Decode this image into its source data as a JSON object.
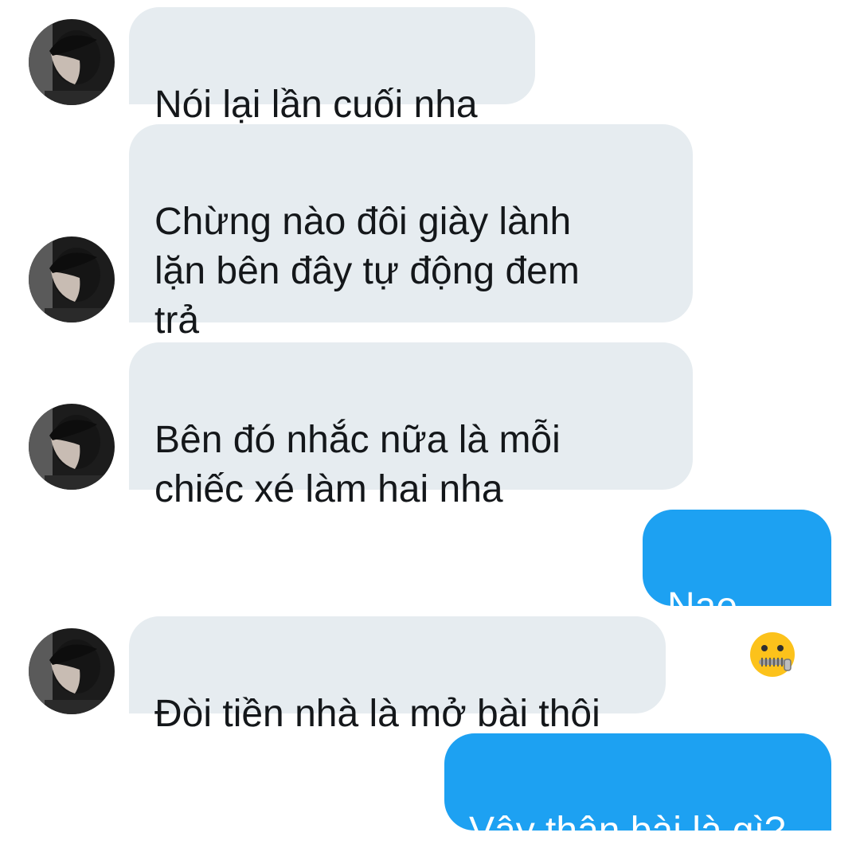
{
  "conversation": {
    "messages": [
      {
        "from": "them",
        "text": "Nói lại lần cuối nha"
      },
      {
        "from": "them",
        "text": "Chừng nào đôi giày lành\nlặn bên đây tự động đem\ntrả"
      },
      {
        "from": "them",
        "text": "Bên đó nhắc nữa là mỗi\nchiếc xé làm hai nha"
      },
      {
        "from": "me",
        "text": "Nae",
        "emoji": "zipper-mouth-face-icon"
      },
      {
        "from": "them",
        "text": "Đòi tiền nhà là mở bài thôi"
      },
      {
        "from": "me",
        "text": "Vậy thân bài là gì?"
      }
    ]
  },
  "colors": {
    "incoming_bubble": "#e6ecf0",
    "outgoing_bubble": "#1da1f2",
    "incoming_text": "#14171a",
    "outgoing_text": "#ffffff"
  },
  "icons": {
    "avatar": "contact-avatar-photo",
    "emoji": "zipper-mouth-face-icon"
  }
}
